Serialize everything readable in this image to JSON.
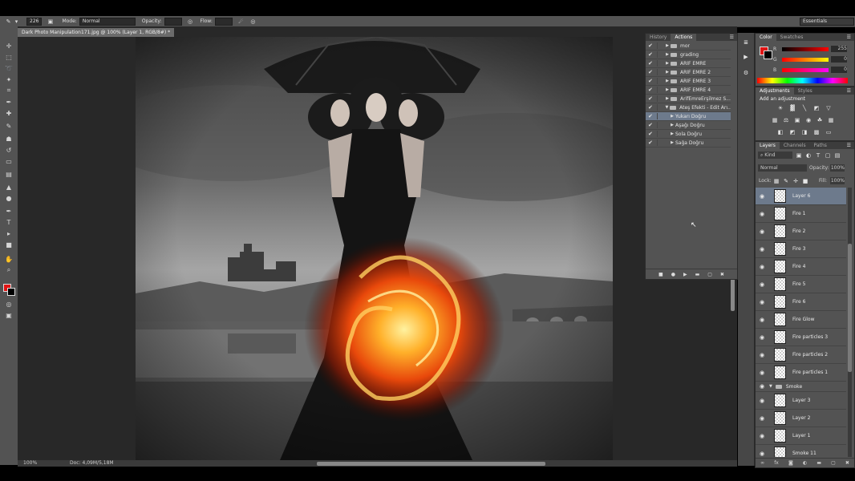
{
  "options_bar": {
    "brush_size": "226",
    "mode_label": "Mode:",
    "mode_value": "Normal",
    "opacity_label": "Opacity:",
    "flow_label": "Flow:",
    "workspace": "Essentials"
  },
  "document": {
    "tab_title": "Dark Photo Manipulation171.jpg @ 100% (Layer 1, RGB/8#) *",
    "zoom": "100%",
    "doc_size": "Doc: 4,09M/5,18M"
  },
  "actions_panel": {
    "tabs": [
      "History",
      "Actions"
    ],
    "items": [
      {
        "label": "mor",
        "type": "set"
      },
      {
        "label": "grading",
        "type": "set"
      },
      {
        "label": "ARİF EMRE",
        "type": "set"
      },
      {
        "label": "ARİF EMRE 2",
        "type": "set"
      },
      {
        "label": "ARİF EMRE 3",
        "type": "set"
      },
      {
        "label": "ARİF EMRE 4",
        "type": "set"
      },
      {
        "label": "ArifEmreErşilmez S...",
        "type": "set"
      },
      {
        "label": "Ateş Efekti - Edit Arı...",
        "type": "set-open"
      },
      {
        "label": "Yukarı Doğru",
        "type": "action",
        "selected": true
      },
      {
        "label": "Aşağı Doğru",
        "type": "action"
      },
      {
        "label": "Sola Doğru",
        "type": "action"
      },
      {
        "label": "Sağa Doğru",
        "type": "action"
      }
    ]
  },
  "color_panel": {
    "tabs": [
      "Color",
      "Swatches"
    ],
    "r": "255",
    "g": "0",
    "b": "0",
    "r_label": "R",
    "g_label": "G",
    "b_label": "B",
    "foreground": "#e01414",
    "background": "#000000"
  },
  "adjustments_panel": {
    "tabs": [
      "Adjustments",
      "Styles"
    ],
    "heading": "Add an adjustment"
  },
  "layers_panel": {
    "tabs": [
      "Layers",
      "Channels",
      "Paths"
    ],
    "kind_label": "Kind",
    "blend_mode": "Normal",
    "opacity_label": "Opacity:",
    "opacity": "100%",
    "lock_label": "Lock:",
    "fill_label": "Fill:",
    "fill": "100%",
    "layers": [
      {
        "name": "Layer 6",
        "selected": true
      },
      {
        "name": "Fire 1"
      },
      {
        "name": "Fire 2"
      },
      {
        "name": "Fire 3"
      },
      {
        "name": "Fire 4"
      },
      {
        "name": "Fire 5"
      },
      {
        "name": "Fire 6"
      },
      {
        "name": "Fire Glow"
      },
      {
        "name": "Fire particles 3"
      },
      {
        "name": "Fire particles 2"
      },
      {
        "name": "Fire particles 1"
      },
      {
        "name": "Smoke",
        "group": true
      },
      {
        "name": "Layer 3"
      },
      {
        "name": "Layer 2"
      },
      {
        "name": "Layer 1"
      },
      {
        "name": "Smoke 11"
      }
    ]
  }
}
